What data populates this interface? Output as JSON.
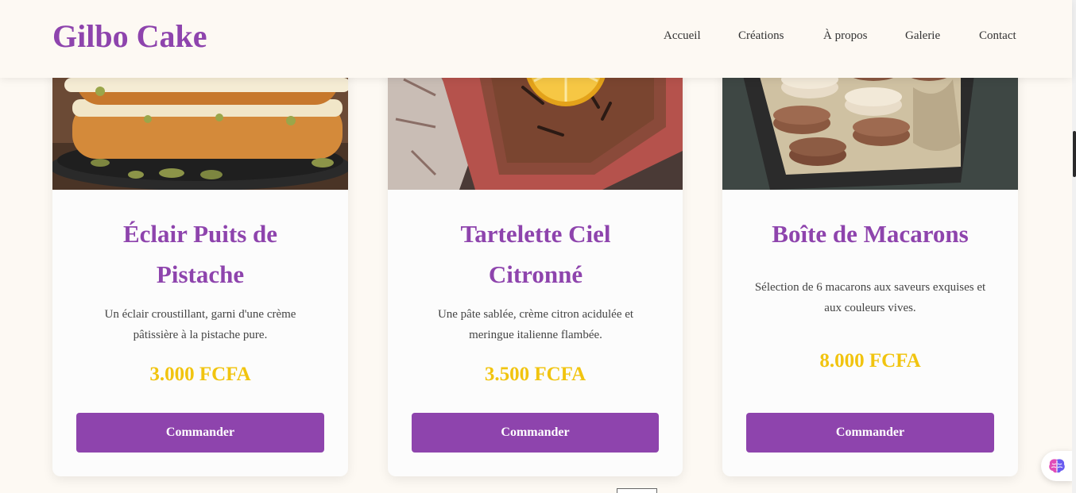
{
  "header": {
    "logo": "Gilbo Cake",
    "nav": [
      "Accueil",
      "Créations",
      "À propos",
      "Galerie",
      "Contact"
    ]
  },
  "products": [
    {
      "title": "Éclair Puits de Pistache",
      "description": "Un éclair croustillant, garni d'une crème pâtissière à la pistache pure.",
      "price": "3.000 FCFA",
      "button": "Commander",
      "image_icon": "pistachio-cake-photo"
    },
    {
      "title": "Tartelette Ciel Citronné",
      "description": "Une pâte sablée, crème citron acidulée et meringue italienne flambée.",
      "price": "3.500 FCFA",
      "button": "Commander",
      "image_icon": "lemon-cake-photo"
    },
    {
      "title": "Boîte de Macarons",
      "description": "Sélection de 6 macarons aux saveurs exquises et aux couleurs vives.",
      "price": "8.000 FCFA",
      "button": "Commander",
      "image_icon": "macaron-box-photo"
    }
  ],
  "colors": {
    "brand": "#8e44ad",
    "price": "#f1c40f",
    "background": "#fdf9f3"
  },
  "floating": {
    "icon": "brain-icon"
  }
}
